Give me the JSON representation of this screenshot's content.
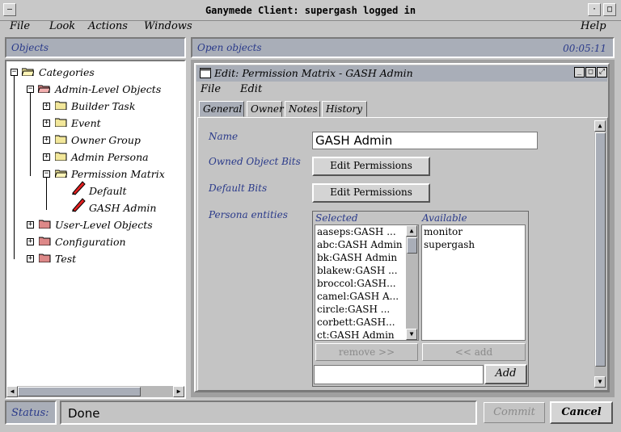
{
  "window": {
    "title": "Ganymede Client: supergash logged in"
  },
  "menubar": {
    "file": "File",
    "look": "Look",
    "actions": "Actions",
    "windows": "Windows",
    "help": "Help"
  },
  "left_pane": {
    "header": "Objects",
    "tree": {
      "categories": "Categories",
      "admin_level": "Admin-Level Objects",
      "builder_task": "Builder Task",
      "event": "Event",
      "owner_group": "Owner Group",
      "admin_persona": "Admin Persona",
      "permission_matrix": "Permission Matrix",
      "default": "Default",
      "gash_admin": "GASH Admin",
      "user_level": "User-Level Objects",
      "configuration": "Configuration",
      "test": "Test"
    }
  },
  "right_pane": {
    "header": "Open objects",
    "clock": "00:05:11"
  },
  "edit_window": {
    "title": "Edit: Permission Matrix - GASH Admin",
    "menu": {
      "file": "File",
      "edit": "Edit"
    },
    "tabs": [
      "General",
      "Owner",
      "Notes",
      "History"
    ],
    "active_tab": "General",
    "fields": {
      "name_label": "Name",
      "name_value": "GASH Admin",
      "owned_bits_label": "Owned Object Bits",
      "owned_bits_button": "Edit Permissions",
      "default_bits_label": "Default Bits",
      "default_bits_button": "Edit Permissions",
      "persona_label": "Persona entities"
    },
    "persona": {
      "selected_header": "Selected",
      "available_header": "Available",
      "selected_items": [
        "aaseps:GASH ...",
        "abc:GASH Admin",
        "bk:GASH Admin",
        "blakew:GASH ...",
        "broccol:GASH...",
        "camel:GASH A...",
        "circle:GASH ...",
        "corbett:GASH...",
        "ct:GASH Admin"
      ],
      "available_items": [
        "monitor",
        "supergash"
      ],
      "remove_button": "remove >>",
      "add_arrow_button": "<< add",
      "add_button": "Add"
    }
  },
  "status": {
    "label": "Status:",
    "value": "Done",
    "commit": "Commit",
    "cancel": "Cancel"
  }
}
